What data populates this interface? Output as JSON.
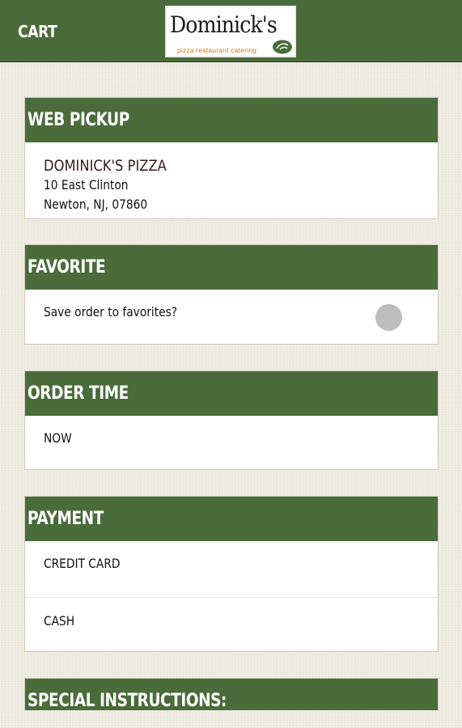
{
  "topbar": {
    "title": "CART",
    "logo": {
      "name": "Dominick's",
      "tagline": "pizza restaurant catering",
      "colors": {
        "bar": "#4a6b3a",
        "tagline": "#cc7a1a"
      }
    }
  },
  "pickup": {
    "header": "WEB PICKUP",
    "store_name": "DOMINICK'S PIZZA",
    "address_line1": "10 East Clinton",
    "address_line2": "Newton, NJ, 07860"
  },
  "favorite": {
    "header": "FAVORITE",
    "prompt": "Save order to favorites?",
    "toggle_on": false
  },
  "order_time": {
    "header": "ORDER TIME",
    "value": "NOW"
  },
  "payment": {
    "header": "PAYMENT",
    "options": [
      "CREDIT CARD",
      "CASH"
    ]
  },
  "special": {
    "header": "SPECIAL INSTRUCTIONS:"
  },
  "colors": {
    "accent": "#4a6b3a",
    "background": "#eeebe0",
    "toggle_off": "#bdbdbd"
  }
}
